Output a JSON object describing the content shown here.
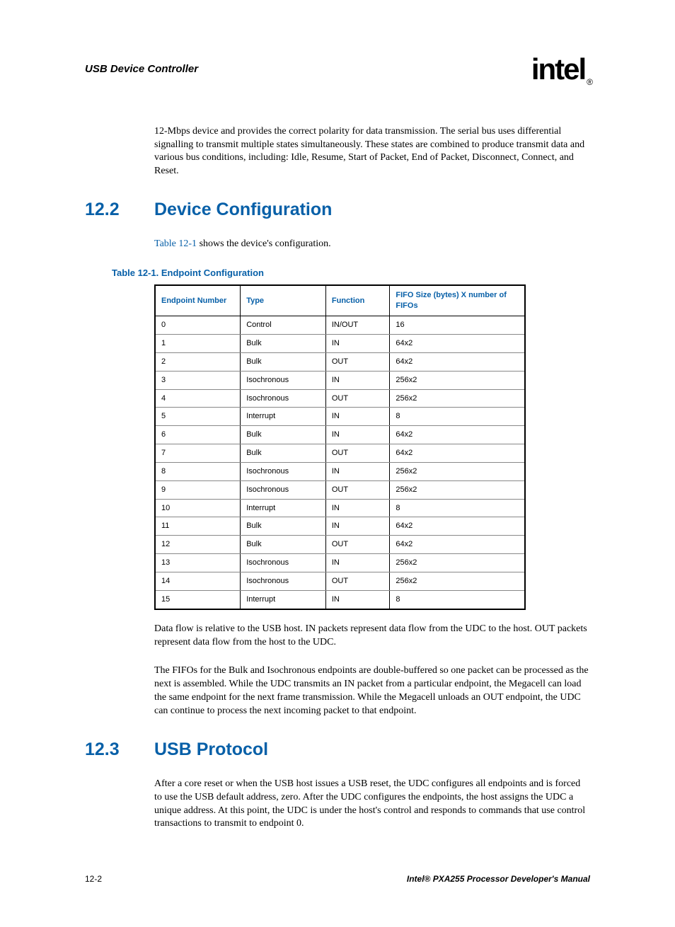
{
  "header": {
    "title": "USB Device Controller",
    "logo": "intel",
    "logo_mark": "®"
  },
  "intro_para": "12-Mbps device and provides the correct polarity for data transmission. The serial bus uses differential signalling to transmit multiple states simultaneously. These states are combined to produce transmit data and various bus conditions, including: Idle, Resume, Start of Packet, End of Packet, Disconnect, Connect, and Reset.",
  "section12_2": {
    "num": "12.2",
    "title": "Device Configuration",
    "intro_link": "Table 12-1",
    "intro_rest": " shows the device's configuration.",
    "table_caption": "Table 12-1. Endpoint Configuration",
    "headers": {
      "c1": "Endpoint Number",
      "c2": "Type",
      "c3": "Function",
      "c4": "FIFO Size (bytes) X number of FIFOs"
    },
    "rows": [
      {
        "num": "0",
        "type": "Control",
        "func": "IN/OUT",
        "fifo": "16"
      },
      {
        "num": "1",
        "type": "Bulk",
        "func": "IN",
        "fifo": "64x2"
      },
      {
        "num": "2",
        "type": "Bulk",
        "func": "OUT",
        "fifo": "64x2"
      },
      {
        "num": "3",
        "type": "Isochronous",
        "func": "IN",
        "fifo": "256x2"
      },
      {
        "num": "4",
        "type": "Isochronous",
        "func": "OUT",
        "fifo": "256x2"
      },
      {
        "num": "5",
        "type": "Interrupt",
        "func": "IN",
        "fifo": "8"
      },
      {
        "num": "6",
        "type": "Bulk",
        "func": "IN",
        "fifo": "64x2"
      },
      {
        "num": "7",
        "type": "Bulk",
        "func": "OUT",
        "fifo": "64x2"
      },
      {
        "num": "8",
        "type": "Isochronous",
        "func": "IN",
        "fifo": "256x2"
      },
      {
        "num": "9",
        "type": "Isochronous",
        "func": "OUT",
        "fifo": "256x2"
      },
      {
        "num": "10",
        "type": "Interrupt",
        "func": "IN",
        "fifo": "8"
      },
      {
        "num": "11",
        "type": "Bulk",
        "func": "IN",
        "fifo": "64x2"
      },
      {
        "num": "12",
        "type": "Bulk",
        "func": "OUT",
        "fifo": "64x2"
      },
      {
        "num": "13",
        "type": "Isochronous",
        "func": "IN",
        "fifo": "256x2"
      },
      {
        "num": "14",
        "type": "Isochronous",
        "func": "OUT",
        "fifo": "256x2"
      },
      {
        "num": "15",
        "type": "Interrupt",
        "func": "IN",
        "fifo": "8"
      }
    ],
    "para_after1": "Data flow is relative to the USB host. IN packets represent data flow from the UDC to the host. OUT packets represent data flow from the host to the UDC.",
    "para_after2": "The FIFOs for the Bulk and Isochronous endpoints are double-buffered so one packet can be processed as the next is assembled. While the UDC transmits an IN packet from a particular endpoint, the Megacell can load the same endpoint for the next frame transmission. While the Megacell unloads an OUT endpoint, the UDC can continue to process the next incoming packet to that endpoint."
  },
  "section12_3": {
    "num": "12.3",
    "title": "USB Protocol",
    "para": "After a core reset or when the USB host issues a USB reset, the UDC configures all endpoints and is forced to use the USB default address, zero. After the UDC configures the endpoints, the host assigns the UDC a unique address. At this point, the UDC is under the host's control and responds to commands that use control transactions to transmit to endpoint 0."
  },
  "footer": {
    "page": "12-2",
    "manual": "Intel® PXA255 Processor Developer's Manual"
  }
}
